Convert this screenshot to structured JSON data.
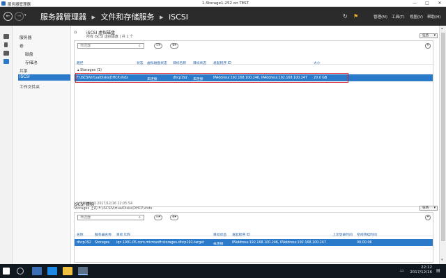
{
  "titlebar": {
    "app_title": "服务器管理器",
    "window_title": "1-Storage1-252 on TEST",
    "minimize": "—",
    "maximize": "□",
    "close": "✕"
  },
  "header": {
    "crumbs": [
      "服务器管理器",
      "文件和存储服务",
      "iSCSI"
    ],
    "separator": "▸",
    "menus": [
      "管理(M)",
      "工具(T)",
      "视图(V)",
      "帮助(H)"
    ]
  },
  "nav": {
    "items": [
      {
        "label": "服务器",
        "level": 0
      },
      {
        "label": "卷",
        "level": 0
      },
      {
        "label": "磁盘",
        "level": 1
      },
      {
        "label": "存储池",
        "level": 1
      },
      {
        "label": "共享",
        "level": 0
      },
      {
        "label": "iSCSI",
        "level": 0,
        "active": true
      },
      {
        "label": "工作文件夹",
        "level": 0
      }
    ]
  },
  "virtual_disks": {
    "title": "iSCSI 虚拟磁盘",
    "subtitle": "所有 iSCSI 虚拟磁盘 | 共 1 个",
    "tasks": "任务",
    "filter_placeholder": "筛选器",
    "columns": [
      "路径",
      "状态",
      "虚拟磁盘状态",
      "目标名称",
      "目标状态",
      "发起程序 ID",
      "大小"
    ],
    "group": "Storages (1)",
    "rows": [
      {
        "path": "F:\\iSCSIVirtualDisks\\DHCP.vhdx",
        "status": "",
        "disk_status": "未连接",
        "target": "dhcp192",
        "target_status": "未连接",
        "initiator": "IPAddress:192.168.100.246, IPAddress:192.168.100.247",
        "size": "20.0 GB"
      }
    ],
    "last_refresh": "上次刷新时间 2017/12/16 22:05:54"
  },
  "targets": {
    "title": "iSCSI 目标",
    "subtitle": "Storages 上的 F:\\iSCSIVirtualDisks\\DHCP.vhdx",
    "tasks": "任务",
    "filter_placeholder": "筛选器",
    "columns": [
      "名称",
      "服务器名称",
      "目标 IQN",
      "目标状态",
      "发起程序 ID",
      "上次登录时间",
      "空闲持续时间"
    ],
    "rows": [
      {
        "name": "dhcp192",
        "server": "Storages",
        "iqn": "iqn.1991-05.com.microsoft:storages-dhcp192-target",
        "status": "未连接",
        "initiator": "IPAddress:192.168.100.246, IPAddress:192.168.100.247",
        "last_login": "",
        "idle": "00:00:06"
      }
    ]
  },
  "taskbar": {
    "time": "22:12",
    "date": "2017/12/16"
  },
  "colors": {
    "header_bg": "#2b2b2b",
    "selection": "#2a7ac9",
    "highlight_box": "#d21f2c"
  }
}
